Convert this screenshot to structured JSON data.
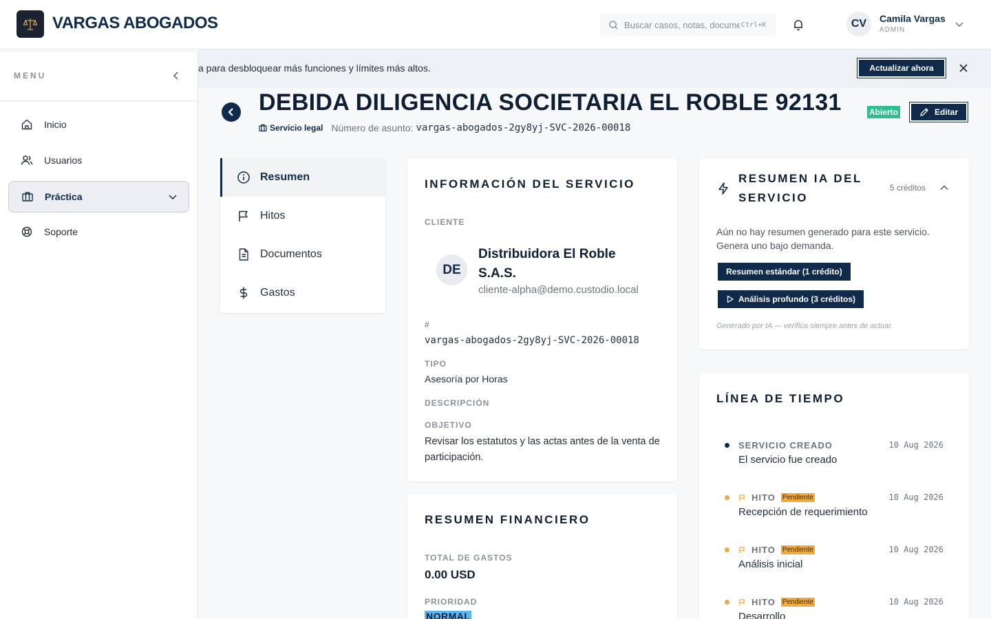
{
  "header": {
    "brand": "VARGAS ABOGADOS",
    "search_placeholder": "Buscar casos, notas, documentos...",
    "search_shortcut": "Ctrl+K",
    "user": {
      "initials": "CV",
      "name": "Camila Vargas",
      "role": "ADMIN"
    }
  },
  "sidebar": {
    "title": "MENU",
    "items": [
      {
        "label": "Inicio",
        "icon": "home-icon"
      },
      {
        "label": "Usuarios",
        "icon": "users-icon"
      },
      {
        "label": "Práctica",
        "icon": "briefcase-icon",
        "active": true
      },
      {
        "label": "Soporte",
        "icon": "lifebuoy-icon"
      }
    ]
  },
  "banner": {
    "text": "a para desbloquear más funciones y límites más altos.",
    "cta": "Actualizar ahora"
  },
  "page": {
    "title": "DEBIDA DILIGENCIA SOCIETARIA EL ROBLE 92131",
    "service_tag": "Servicio legal",
    "matter_label": "Número de asunto:",
    "matter_number": "vargas-abogados-2gy8yj-SVC-2026-00018",
    "status": "Abierto",
    "edit_label": "Editar"
  },
  "tabs": [
    {
      "label": "Resumen",
      "icon": "info-icon",
      "active": true
    },
    {
      "label": "Hitos",
      "icon": "flag-icon"
    },
    {
      "label": "Documentos",
      "icon": "document-icon"
    },
    {
      "label": "Gastos",
      "icon": "dollar-icon"
    }
  ],
  "service_info": {
    "title": "INFORMACIÓN DEL SERVICIO",
    "client_label": "CLIENTE",
    "client_initials": "DE",
    "client_name": "Distribuidora El Roble S.A.S.",
    "client_email": "cliente-alpha@demo.custodio.local",
    "number_label": "#",
    "number_value": "vargas-abogados-2gy8yj-SVC-2026-00018",
    "type_label": "TIPO",
    "type_value": "Asesoría por Horas",
    "description_label": "DESCRIPCIÓN",
    "objective_label": "OBJETIVO",
    "objective_value": "Revisar los estatutos y las actas antes de la venta de participación."
  },
  "financial": {
    "title": "RESUMEN FINANCIERO",
    "total_label": "TOTAL DE GASTOS",
    "total_value": "0.00 USD",
    "priority_label": "PRIORIDAD",
    "priority_value": "NORMAL"
  },
  "ai_summary": {
    "title": "RESUMEN IA DEL SERVICIO",
    "credits": "5 créditos",
    "note": "Aún no hay resumen generado para este servicio. Genera uno bajo demanda.",
    "standard_btn": "Resumen estándar (1 crédito)",
    "deep_btn": "Análisis profundo (3 créditos)",
    "footer": "Generado por IA — verifica siempre antes de actuar."
  },
  "timeline": {
    "title": "LÍNEA DE TIEMPO",
    "items": [
      {
        "kind": "SERVICIO CREADO",
        "date": "10 Aug 2026",
        "desc": "El servicio fue creado",
        "pending": "",
        "dot": "#0f2a4a"
      },
      {
        "kind": "HITO",
        "date": "10 Aug 2026",
        "desc": "Recepción de requerimiento",
        "pending": "Pendiente",
        "dot": "#f2a93b"
      },
      {
        "kind": "HITO",
        "date": "10 Aug 2026",
        "desc": "Análisis inicial",
        "pending": "Pendiente",
        "dot": "#f2a93b"
      },
      {
        "kind": "HITO",
        "date": "10 Aug 2026",
        "desc": "Desarrollo",
        "pending": "Pendiente",
        "dot": "#f2a93b"
      }
    ]
  },
  "colors": {
    "primary": "#0f2a4a",
    "success": "#2fbf8f",
    "warning": "#f2a93b",
    "info": "#5bb8f5"
  }
}
